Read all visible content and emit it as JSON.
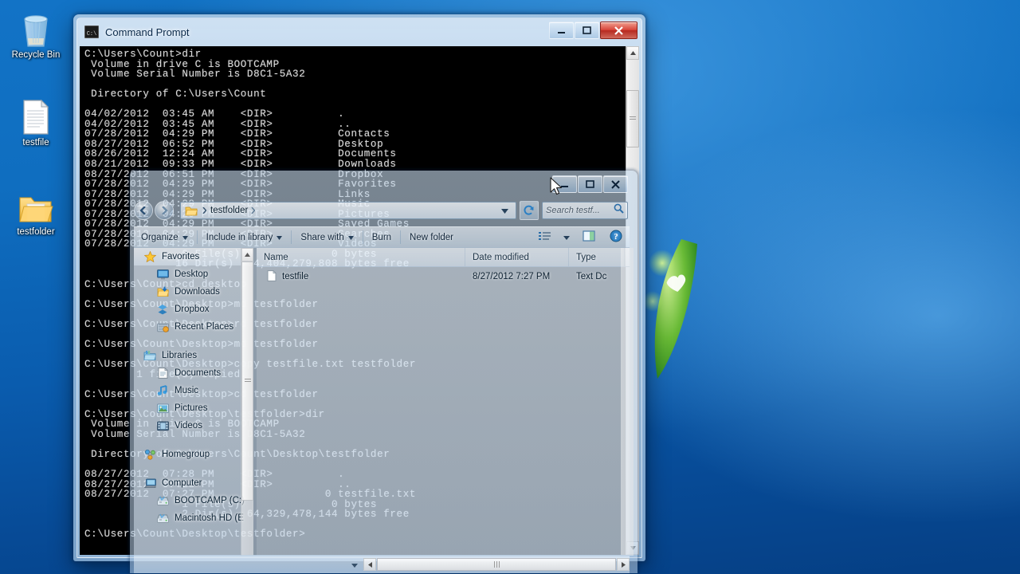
{
  "desktop": {
    "icons": [
      {
        "name": "recycle-bin",
        "label": "Recycle Bin",
        "icon": "recycle-bin-icon"
      },
      {
        "name": "testfile",
        "label": "testfile",
        "icon": "text-file-icon"
      },
      {
        "name": "testfolder",
        "label": "testfolder",
        "icon": "folder-icon"
      }
    ]
  },
  "cmd": {
    "title": "Command Prompt",
    "icon": "command-prompt-icon",
    "minimize_label": "Minimize",
    "maximize_label": "Maximize",
    "close_label": "Close",
    "console_text": "C:\\Users\\Count>dir\n Volume in drive C is BOOTCAMP\n Volume Serial Number is D8C1-5A32\n\n Directory of C:\\Users\\Count\n\n04/02/2012  03:45 AM    <DIR>          .\n04/02/2012  03:45 AM    <DIR>          ..\n07/28/2012  04:29 PM    <DIR>          Contacts\n08/27/2012  06:52 PM    <DIR>          Desktop\n08/26/2012  12:24 AM    <DIR>          Documents\n08/21/2012  09:33 PM    <DIR>          Downloads\n08/27/2012  06:51 PM    <DIR>          Dropbox\n07/28/2012  04:29 PM    <DIR>          Favorites\n07/28/2012  04:29 PM    <DIR>          Links\n07/28/2012  04:29 PM    <DIR>          Music\n07/28/2012  04:29 PM    <DIR>          Pictures\n07/28/2012  04:29 PM    <DIR>          Saved Games\n07/28/2012  04:29 PM    <DIR>          Searches\n07/28/2012  04:29 PM    <DIR>          Videos\n               0 File(s)              0 bytes\n              16 Dir(s)  64,404,279,808 bytes free\n\nC:\\Users\\Count>cd desktop\n\nC:\\Users\\Count\\Desktop>md testfolder\n\nC:\\Users\\Count\\Desktop>rd testfolder\n\nC:\\Users\\Count\\Desktop>md testfolder\n\nC:\\Users\\Count\\Desktop>copy testfile.txt testfolder\n        1 file(s) copied.\n\nC:\\Users\\Count\\Desktop>cd testfolder\n\nC:\\Users\\Count\\Desktop\\testfolder>dir\n Volume in drive C is BOOTCAMP\n Volume Serial Number is D8C1-5A32\n\n Directory of C:\\Users\\Count\\Desktop\\testfolder\n\n08/27/2012  07:28 PM    <DIR>          .\n08/27/2012  07:28 PM    <DIR>          ..\n08/27/2012  07:27 PM                 0 testfile.txt\n               1 File(s)              0 bytes\n               2 Dir(s)  64,329,478,144 bytes free\n\nC:\\Users\\Count\\Desktop\\testfolder>"
  },
  "explorer": {
    "minimize_label": "Minimize",
    "maximize_label": "Maximize",
    "close_label": "Close",
    "back_label": "Back",
    "forward_label": "Forward",
    "address": {
      "crumb": "testfolder",
      "icon": "folder-icon"
    },
    "refresh_label": "Refresh",
    "search": {
      "placeholder": "Search testf...",
      "icon": "search-icon"
    },
    "toolbar": [
      {
        "name": "organize",
        "label": "Organize",
        "dropdown": true
      },
      {
        "name": "include-in-library",
        "label": "Include in library",
        "dropdown": true
      },
      {
        "name": "share-with",
        "label": "Share with",
        "dropdown": true
      },
      {
        "name": "burn",
        "label": "Burn",
        "dropdown": false
      },
      {
        "name": "new-folder",
        "label": "New folder",
        "dropdown": false
      }
    ],
    "toolbar_right": [
      {
        "name": "change-view",
        "icon": "view-list-icon"
      },
      {
        "name": "view-dropdown",
        "icon": "chevron-down-icon"
      },
      {
        "name": "preview-pane",
        "icon": "preview-pane-icon"
      },
      {
        "name": "help",
        "icon": "help-icon"
      }
    ],
    "nav_pane": [
      {
        "name": "favorites",
        "label": "Favorites",
        "icon": "star-icon",
        "level": "hdr"
      },
      {
        "name": "desktop",
        "label": "Desktop",
        "icon": "desktop-icon",
        "level": "child"
      },
      {
        "name": "downloads",
        "label": "Downloads",
        "icon": "downloads-icon",
        "level": "child"
      },
      {
        "name": "dropbox",
        "label": "Dropbox",
        "icon": "dropbox-icon",
        "level": "child"
      },
      {
        "name": "recent-places",
        "label": "Recent Places",
        "icon": "recent-places-icon",
        "level": "child"
      },
      {
        "name": "spacer",
        "label": "",
        "icon": "",
        "level": "spacer"
      },
      {
        "name": "libraries",
        "label": "Libraries",
        "icon": "libraries-icon",
        "level": "hdr"
      },
      {
        "name": "documents",
        "label": "Documents",
        "icon": "documents-icon",
        "level": "child"
      },
      {
        "name": "music",
        "label": "Music",
        "icon": "music-icon",
        "level": "child"
      },
      {
        "name": "pictures",
        "label": "Pictures",
        "icon": "pictures-icon",
        "level": "child"
      },
      {
        "name": "videos",
        "label": "Videos",
        "icon": "videos-icon",
        "level": "child"
      },
      {
        "name": "spacer",
        "label": "",
        "icon": "",
        "level": "spacer"
      },
      {
        "name": "homegroup",
        "label": "Homegroup",
        "icon": "homegroup-icon",
        "level": "hdr"
      },
      {
        "name": "spacer",
        "label": "",
        "icon": "",
        "level": "spacer"
      },
      {
        "name": "computer",
        "label": "Computer",
        "icon": "computer-icon",
        "level": "hdr"
      },
      {
        "name": "bootcamp-c",
        "label": "BOOTCAMP (C:)",
        "icon": "hard-drive-icon",
        "level": "child"
      },
      {
        "name": "macintosh-hd-e",
        "label": "Macintosh HD (E",
        "icon": "hard-drive-icon",
        "level": "child"
      }
    ],
    "columns": [
      {
        "name": "name",
        "label": "Name"
      },
      {
        "name": "date-modified",
        "label": "Date modified"
      },
      {
        "name": "type",
        "label": "Type"
      }
    ],
    "files": [
      {
        "name": "testfile",
        "label": "testfile",
        "date": "8/27/2012 7:27 PM",
        "type": "Text Dc",
        "icon": "text-file-icon"
      }
    ]
  },
  "colors": {
    "desktop_blue": "#0f6ec0",
    "cmd_background": "#000000",
    "cmd_text": "#d9d9d9",
    "close_button_red": "#d8453a",
    "aero_glass": "#c4d8eb"
  }
}
